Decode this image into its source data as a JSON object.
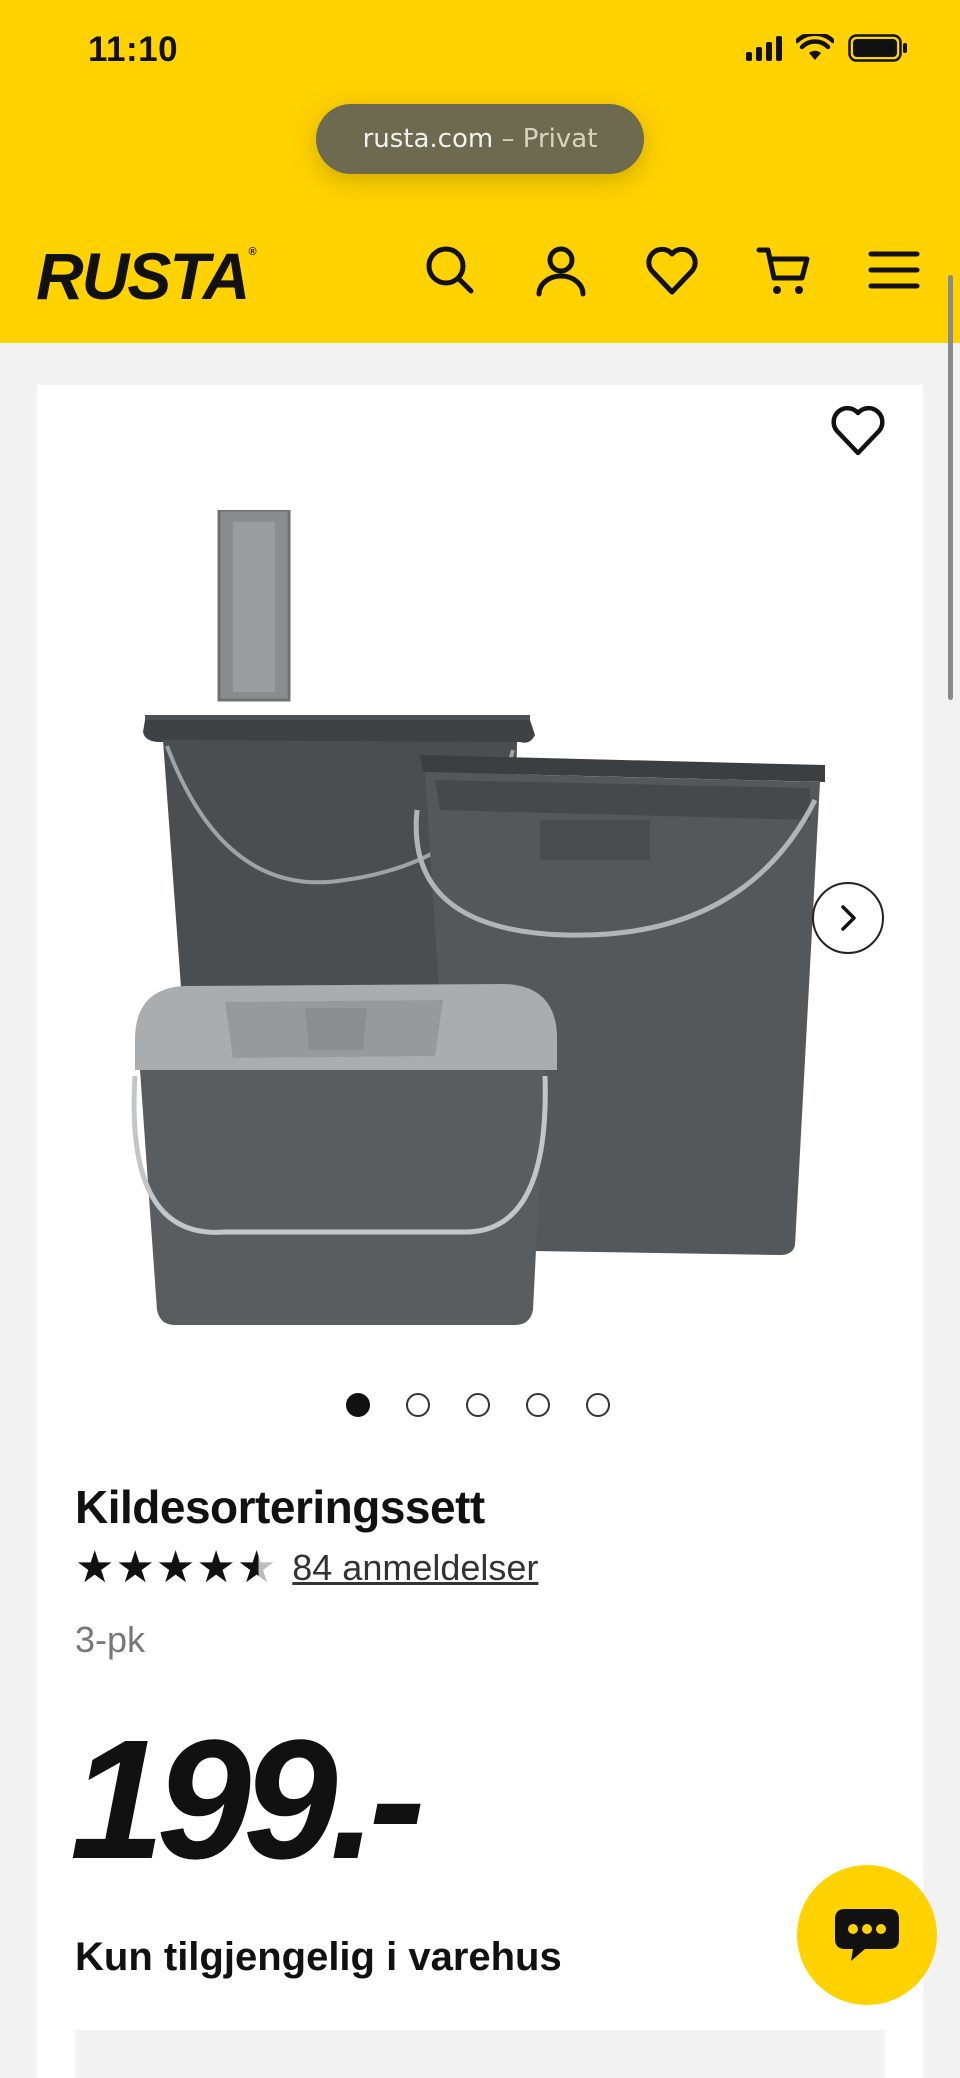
{
  "status_bar": {
    "time": "11:10"
  },
  "browser": {
    "domain": "rusta.com",
    "mode": "– Privat"
  },
  "header": {
    "logo": "RUSTA",
    "logo_mark": "®",
    "icons": [
      "search-icon",
      "account-icon",
      "heart-icon",
      "cart-icon",
      "menu-icon"
    ]
  },
  "colors": {
    "brand_yellow": "#ffd200",
    "text": "#111111",
    "muted": "#777777"
  },
  "product": {
    "title": "Kildesorteringssett",
    "rating": 4.5,
    "rating_max": 5,
    "reviews_label": "84 anmeldelser",
    "variant": "3-pk",
    "price": "199.-",
    "availability": "Kun tilgjengelig i varehus",
    "image_count": 5,
    "active_image": 1
  }
}
